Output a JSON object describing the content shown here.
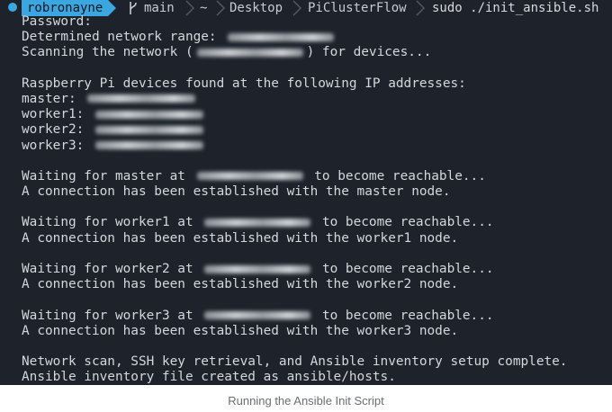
{
  "prompt": {
    "user": "robronayne",
    "branch": "main",
    "path": [
      "~",
      "Desktop",
      "PiClusterFlow"
    ],
    "command": "sudo ./init_ansible.sh"
  },
  "output": {
    "password": "Password:",
    "range_prefix": "Determined network range: ",
    "scan_prefix": "Scanning the network (",
    "scan_suffix": ") for devices...",
    "found_header": "Raspberry Pi devices found at the following IP addresses:",
    "devices": [
      {
        "label": "master: "
      },
      {
        "label": "worker1: "
      },
      {
        "label": "worker2: "
      },
      {
        "label": "worker3: "
      }
    ],
    "waits": [
      {
        "prefix": "Waiting for master at ",
        "suffix": " to become reachable...",
        "established": "A connection has been established with the master node."
      },
      {
        "prefix": "Waiting for worker1 at ",
        "suffix": " to become reachable...",
        "established": "A connection has been established with the worker1 node."
      },
      {
        "prefix": "Waiting for worker2 at ",
        "suffix": " to become reachable...",
        "established": "A connection has been established with the worker2 node."
      },
      {
        "prefix": "Waiting for worker3 at ",
        "suffix": " to become reachable...",
        "established": "A connection has been established with the worker3 node."
      }
    ],
    "complete": "Network scan, SSH key retrieval, and Ansible inventory setup complete.",
    "inventory": "Ansible inventory file created as ansible/hosts."
  },
  "caption": "Running the Ansible Init Script",
  "colors": {
    "terminal_bg": "#1d222b",
    "user_segment": "#3aa7e0",
    "text": "#d4d7dc"
  }
}
